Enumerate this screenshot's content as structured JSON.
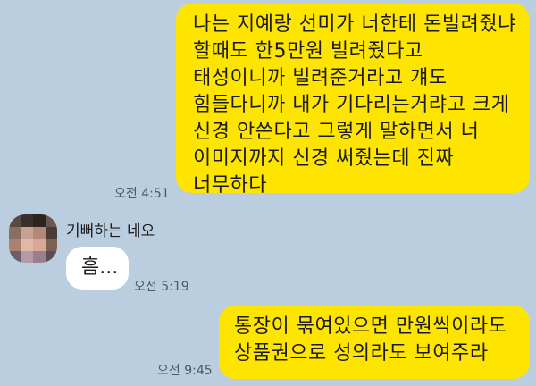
{
  "messages": [
    {
      "side": "out",
      "lines": [
        "나는 지예랑 선미가 너한테 돈빌려줬냐",
        "할때도 한5만원 빌려줬다고",
        "태성이니까 빌려준거라고 걔도",
        "힘들다니까 내가 기다리는거랴고 크게",
        "신경 안쓴다고 그렇게 말하면서 너",
        "이미지까지 신경 써줬는데 진짜",
        "너무하다"
      ],
      "time": "오전 4:51"
    },
    {
      "side": "in",
      "sender": "기뻐하는 네오",
      "text": "흠...",
      "time": "오전 5:19"
    },
    {
      "side": "out",
      "lines": [
        "통장이 묶여있으면 만원씩이라도",
        "상품권으로 성의라도 보여주라"
      ],
      "time": "오전 9:45"
    }
  ],
  "colors": {
    "background": "#bacee0",
    "outgoing_bubble": "#fee500",
    "incoming_bubble": "#ffffff"
  },
  "avatar": {
    "icon": "pixelated-profile-photo",
    "pixels": [
      "#5a4a44",
      "#3a2f2d",
      "#2d2422",
      "#6b5750",
      "#8a6e62",
      "#c9a193",
      "#b48878",
      "#4a3b36",
      "#a98272",
      "#e0b8a8",
      "#d7a897",
      "#7c5f55",
      "#6f5c6a",
      "#b59aa6",
      "#9a7f8c",
      "#5c4c58"
    ]
  }
}
